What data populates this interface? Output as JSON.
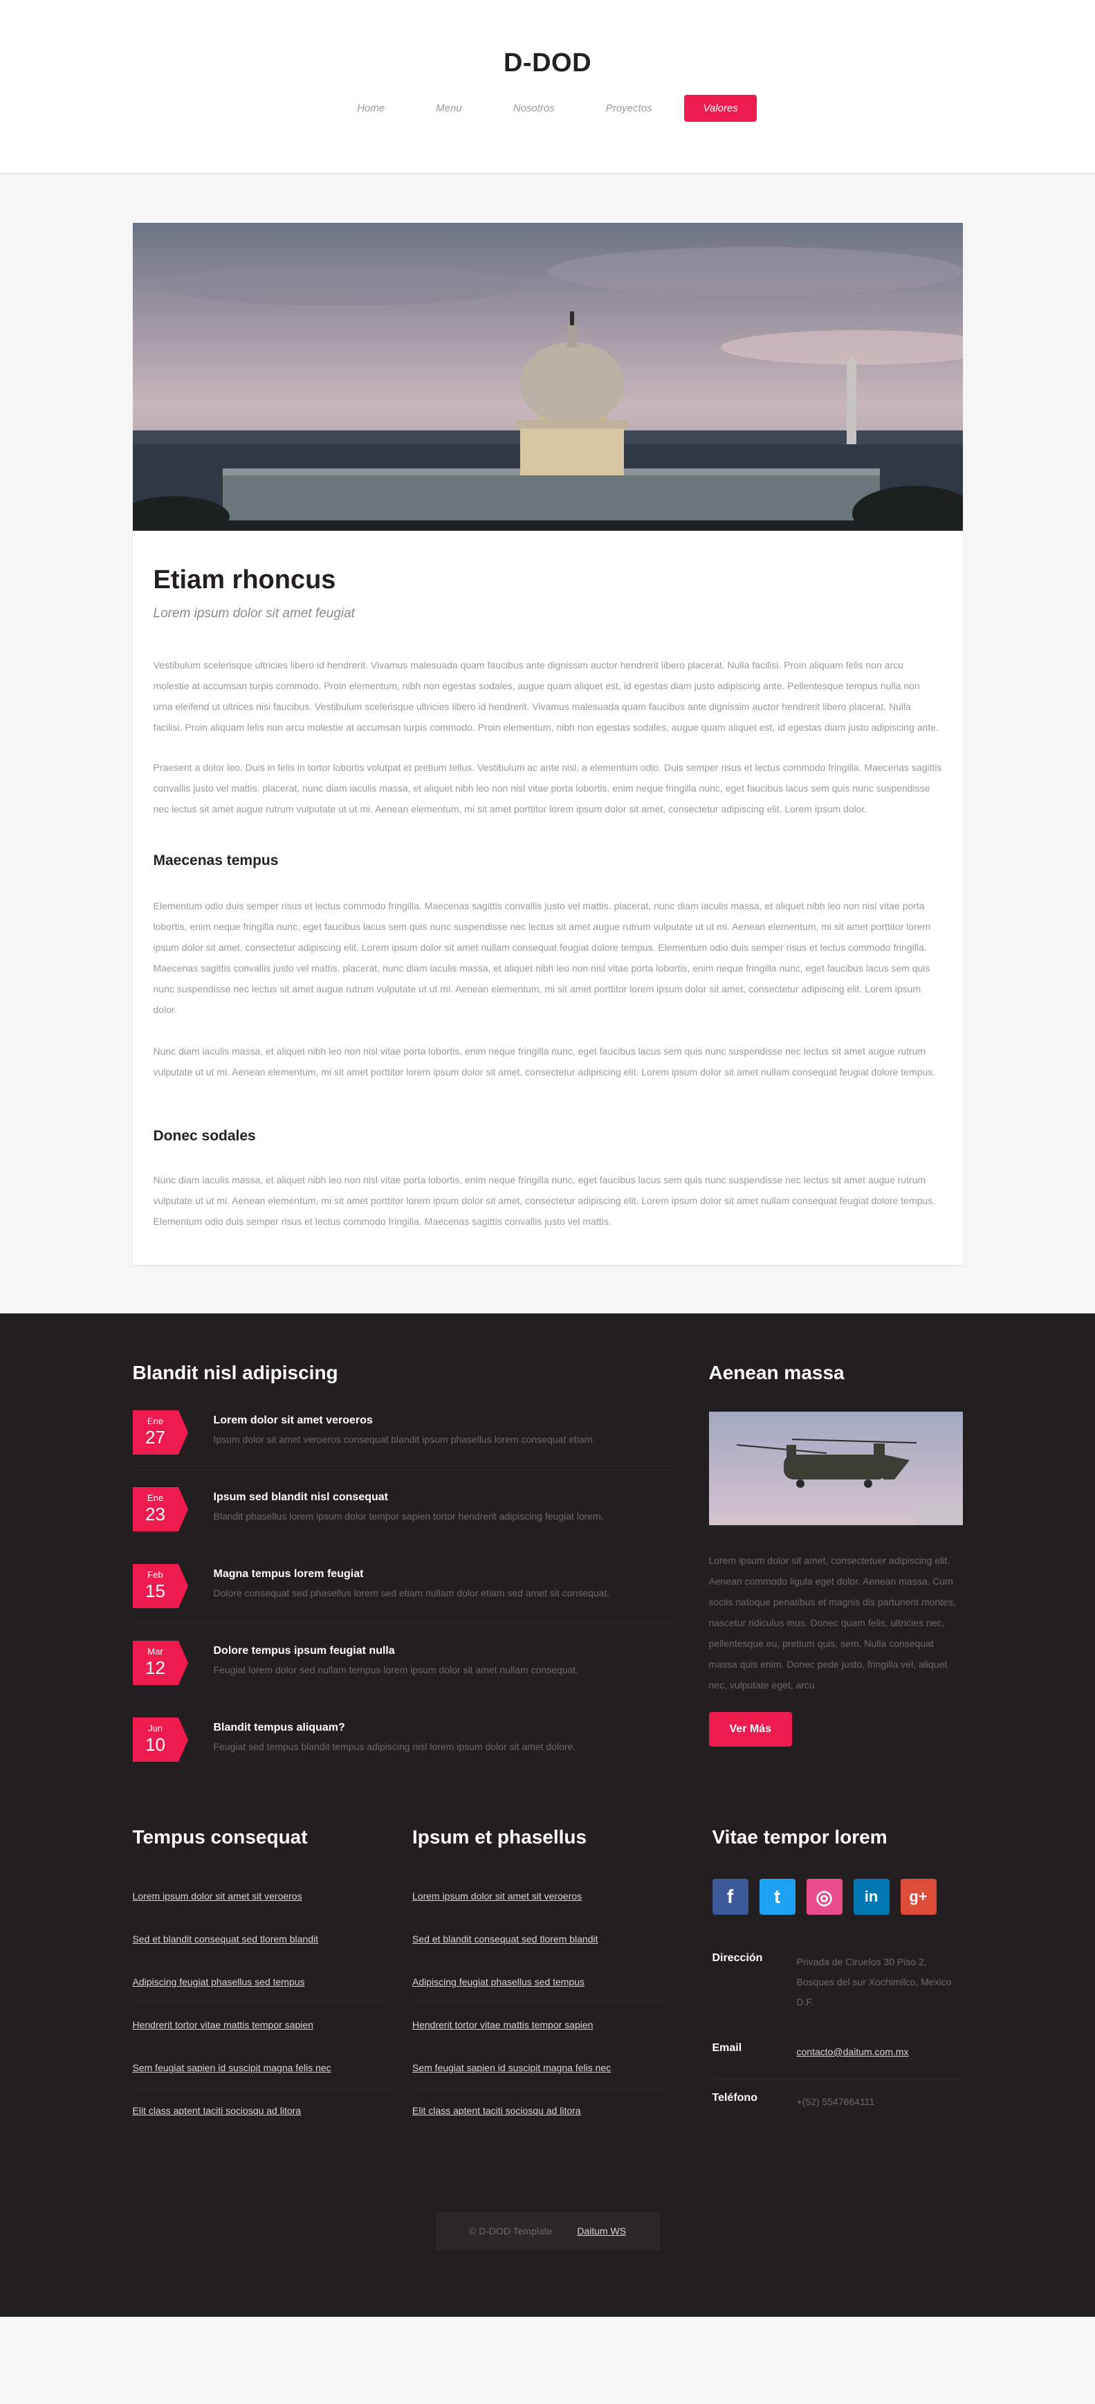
{
  "site": {
    "logo": "D-DOD"
  },
  "nav": [
    {
      "label": "Home"
    },
    {
      "label": "Menu"
    },
    {
      "label": "Nosotros"
    },
    {
      "label": "Proyectos"
    },
    {
      "label": "Valores",
      "active": true
    }
  ],
  "article": {
    "title": "Etiam rhoncus",
    "subtitle": "Lorem ipsum dolor sit amet feugiat",
    "p1": "Vestibulum scelerisque ultricies libero id hendrerit. Vivamus malesuada quam faucibus ante dignissim auctor hendrerit libero placerat. Nulla facilisi. Proin aliquam felis non arcu molestie at accumsan turpis commodo. Proin elementum, nibh non egestas sodales, augue quam aliquet est, id egestas diam justo adipiscing ante. Pellentesque tempus nulla non urna eleifend ut ultrices nisi faucibus. Vestibulum scelerisque ultricies libero id hendrerit. Vivamus malesuada quam faucibus ante dignissim auctor hendrerit libero placerat. Nulla facilisi. Proin aliquam felis non arcu molestie at accumsan turpis commodo. Proin elementum, nibh non egestas sodales, augue quam aliquet est, id egestas diam justo adipiscing ante.",
    "p2": "Praesent a dolor leo. Duis in felis in tortor lobortis volutpat et pretium tellus. Vestibulum ac ante nisl, a elementum odio. Duis semper risus et lectus commodo fringilla. Maecenas sagittis convallis justo vel mattis. placerat, nunc diam iaculis massa, et aliquet nibh leo non nisl vitae porta lobortis, enim neque fringilla nunc, eget faucibus lacus sem quis nunc suspendisse nec lectus sit amet augue rutrum vulputate ut ut mi. Aenean elementum, mi sit amet porttitor lorem ipsum dolor sit amet, consectetur adipiscing elit. Lorem ipsum dolor.",
    "h2": "Maecenas tempus",
    "p3": "Elementum odio duis semper risus et lectus commodo fringilla. Maecenas sagittis convallis justo vel mattis. placerat, nunc diam iaculis massa, et aliquet nibh leo non nisl vitae porta lobortis, enim neque fringilla nunc, eget faucibus lacus sem quis nunc suspendisse nec lectus sit amet augue rutrum vulputate ut ut mi. Aenean elementum, mi sit amet porttitor lorem ipsum dolor sit amet, consectetur adipiscing elit. Lorem ipsum dolor sit amet nullam consequat feugiat dolore tempus. Elementum odio duis semper risus et lectus commodo fringilla. Maecenas sagittis convallis justo vel mattis. placerat, nunc diam iaculis massa, et aliquet nibh leo non nisl vitae porta lobortis, enim neque fringilla nunc, eget faucibus lacus sem quis nunc suspendisse nec lectus sit amet augue rutrum vulputate ut ut mi. Aenean elementum, mi sit amet porttitor lorem ipsum dolor sit amet, consectetur adipiscing elit. Lorem ipsum dolor.",
    "p4": "Nunc diam iaculis massa, et aliquet nibh leo non nisl vitae porta lobortis, enim neque fringilla nunc, eget faucibus lacus sem quis nunc suspendisse nec lectus sit amet augue rutrum vulputate ut ut mi. Aenean elementum, mi sit amet porttitor lorem ipsum dolor sit amet, consectetur adipiscing elit. Lorem ipsum dolor sit amet nullam consequat feugiat dolore tempus.",
    "h3": "Donec sodales",
    "p5": "Nunc diam iaculis massa, et aliquet nibh leo non nisl vitae porta lobortis, enim neque fringilla nunc, eget faucibus lacus sem quis nunc suspendisse nec lectus sit amet augue rutrum vulputate ut ut mi. Aenean elementum, mi sit amet porttitor lorem ipsum dolor sit amet, consectetur adipiscing elit. Lorem ipsum dolor sit amet nullam consequat feugiat dolore tempus. Elementum odio duis semper risus et lectus commodo fringilla. Maecenas sagittis convallis justo vel mattis."
  },
  "events": {
    "title": "Blandit nisl adipiscing",
    "items": [
      {
        "month": "Ene",
        "day": "27",
        "title": "Lorem dolor sit amet veroeros",
        "desc": "Ipsum dolor sit amet veroeros consequat blandit ipsum phasellus lorem consequat etiam."
      },
      {
        "month": "Ene",
        "day": "23",
        "title": "Ipsum sed blandit nisl consequat",
        "desc": "Blandit phasellus lorem ipsum dolor tempor sapien tortor hendrerit adipiscing feugiat lorem."
      },
      {
        "month": "Feb",
        "day": "15",
        "title": "Magna tempus lorem feugiat",
        "desc": "Dolore consequat sed phasellus lorem sed etiam nullam dolor etiam sed amet sit consequat."
      },
      {
        "month": "Mar",
        "day": "12",
        "title": "Dolore tempus ipsum feugiat nulla",
        "desc": "Feugiat lorem dolor sed nullam tempus lorem ipsum dolor sit amet nullam consequat."
      },
      {
        "month": "Jun",
        "day": "10",
        "title": "Blandit tempus aliquam?",
        "desc": "Feugiat sed tempus blandit tempus adipiscing nisl lorem ipsum dolor sit amet dolore."
      }
    ]
  },
  "aside": {
    "title": "Aenean massa",
    "text": "Lorem ipsum dolor sit amet, consectetuer adipiscing elit. Aenean commodo ligula eget dolor. Aenean massa. Cum sociis natoque penatibus et magnis dis parturient montes, nascetur ridiculus mus. Donec quam felis, ultricies nec, pellentesque eu, pretium quis, sem. Nulla consequat massa quis enim. Donec pede justo, fringilla vel, aliquet nec, vulputate eget, arcu.",
    "button": "Ver Más"
  },
  "col1": {
    "title": "Tempus consequat",
    "links": [
      "Lorem ipsum dolor sit amet sit veroeros",
      "Sed et blandit consequat sed tlorem blandit",
      "Adipiscing feugiat phasellus sed tempus",
      "Hendrerit tortor vitae mattis tempor sapien",
      "Sem feugiat sapien id suscipit magna felis nec",
      "Elit class aptent taciti sociosqu ad litora"
    ]
  },
  "col2": {
    "title": "Ipsum et phasellus",
    "links": [
      "Lorem ipsum dolor sit amet sit veroeros",
      "Sed et blandit consequat sed tlorem blandit",
      "Adipiscing feugiat phasellus sed tempus",
      "Hendrerit tortor vitae mattis tempor sapien",
      "Sem feugiat sapien id suscipit magna felis nec",
      "Elit class aptent taciti sociosqu ad litora"
    ]
  },
  "col3": {
    "title": "Vitae tempor lorem",
    "social": [
      {
        "icon": "facebook-icon",
        "glyph": "f",
        "color": "#3b5998"
      },
      {
        "icon": "twitter-icon",
        "glyph": "t",
        "color": "#1da1f2"
      },
      {
        "icon": "dribbble-icon",
        "glyph": "◎",
        "color": "#ea4c89"
      },
      {
        "icon": "linkedin-icon",
        "glyph": "in",
        "color": "#0077b5"
      },
      {
        "icon": "google-plus-icon",
        "glyph": "g+",
        "color": "#dd4b39"
      }
    ],
    "address_label": "Dirección",
    "address": "Privada de Ciruelos 30 Piso 2, Bosques del sur Xochimilco, Mexico D.F.",
    "email_label": "Email",
    "email": "contacto@daitum.com.mx",
    "phone_label": "Teléfono",
    "phone": "+(52) 5547664111"
  },
  "copyright": {
    "text": "© D-DOD Template",
    "link": "Daitum WS"
  },
  "colors": {
    "accent": "#ef1a4d",
    "dark": "#231f20"
  }
}
